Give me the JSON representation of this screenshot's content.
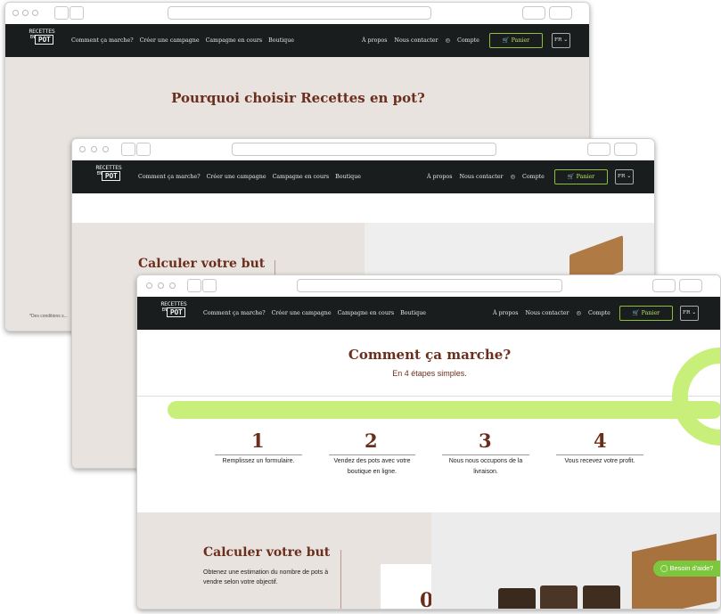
{
  "nav": {
    "logo_top": "RECETTES",
    "logo_en": "EN",
    "logo_pot": "POT",
    "links": [
      "Comment ça marche?",
      "Créer une campagne",
      "Campagne en cours",
      "Boutique"
    ],
    "about": "À propos",
    "contact": "Nous contacter",
    "account": "Compte",
    "cart": "Panier",
    "lang": "FR"
  },
  "window1": {
    "heading": "Pourquoi choisir Recettes en pot?",
    "footnote": "*Des conditions s..."
  },
  "window2": {
    "heading": "Calculer votre but"
  },
  "window3": {
    "heading": "Comment ça marche?",
    "subheading": "En 4 étapes simples.",
    "steps": [
      {
        "number": "1",
        "text": "Remplissez un formulaire."
      },
      {
        "number": "2",
        "text": "Vendez des pots avec votre boutique en ligne."
      },
      {
        "number": "3",
        "text": "Nous nous occupons de la livraison."
      },
      {
        "number": "4",
        "text": "Vous recevez votre profit."
      }
    ],
    "calc_heading": "Calculer votre but",
    "calc_text": "Obtenez une estimation du nombre de pots à vendre selon votre objectif.",
    "calc_value": "0",
    "help_button": "Besoin d'aide?"
  },
  "colors": {
    "nav_bg": "#1a1d1d",
    "accent_green": "#b7e463",
    "brand_brown": "#6b2e1c",
    "beige": "#e8e3de"
  }
}
